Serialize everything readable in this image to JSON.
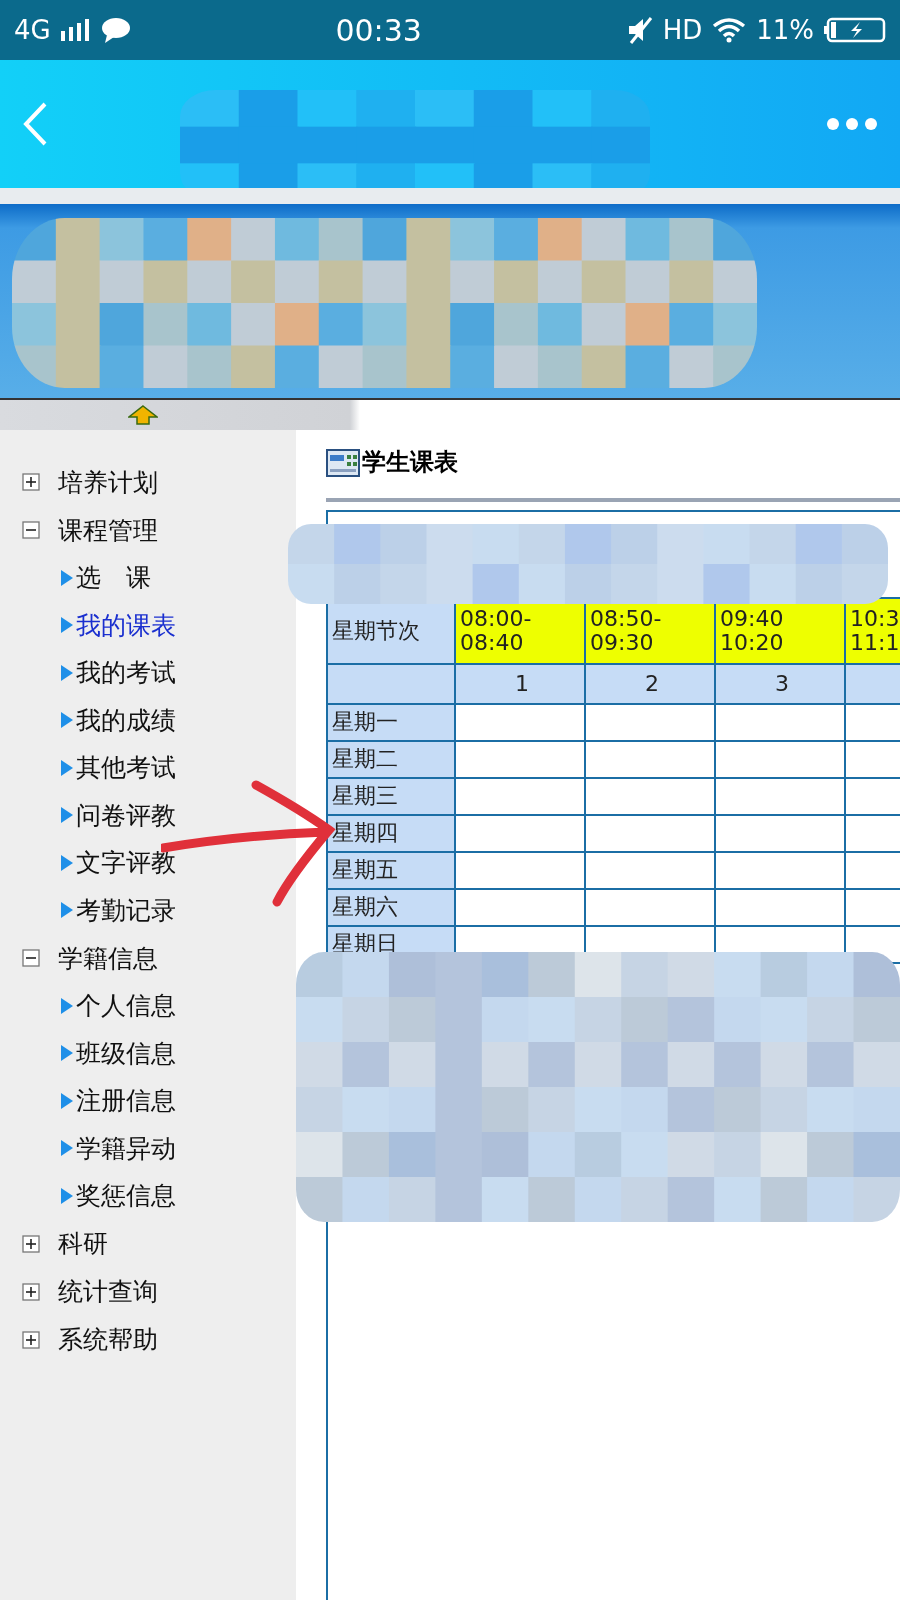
{
  "status_bar": {
    "network": "4G",
    "time": "00:33",
    "hd": "HD",
    "battery": "11%"
  },
  "sidebar": {
    "items": [
      {
        "label": "培养计划",
        "expanded": false
      },
      {
        "label": "课程管理",
        "expanded": true,
        "children": [
          {
            "label": "选　课",
            "selected": false
          },
          {
            "label": "我的课表",
            "selected": true
          },
          {
            "label": "我的考试",
            "selected": false
          },
          {
            "label": "我的成绩",
            "selected": false
          },
          {
            "label": "其他考试",
            "selected": false
          },
          {
            "label": "问卷评教",
            "selected": false
          },
          {
            "label": "文字评教",
            "selected": false
          },
          {
            "label": "考勤记录",
            "selected": false
          }
        ]
      },
      {
        "label": "学籍信息",
        "expanded": true,
        "children": [
          {
            "label": "个人信息",
            "selected": false
          },
          {
            "label": "班级信息",
            "selected": false
          },
          {
            "label": "注册信息",
            "selected": false
          },
          {
            "label": "学籍异动",
            "selected": false
          },
          {
            "label": "奖惩信息",
            "selected": false
          }
        ]
      },
      {
        "label": "科研",
        "expanded": false
      },
      {
        "label": "统计查询",
        "expanded": false
      },
      {
        "label": "系统帮助",
        "expanded": false
      }
    ]
  },
  "content": {
    "title": "学生课表",
    "table": {
      "corner": "星期节次",
      "times": [
        [
          "08:00-",
          "08:40"
        ],
        [
          "08:50-",
          "09:30"
        ],
        [
          "09:40",
          "10:20"
        ],
        [
          "10:3",
          "11:1"
        ]
      ],
      "periods": [
        "1",
        "2",
        "3"
      ],
      "days": [
        "星期一",
        "星期二",
        "星期三",
        "星期四",
        "星期五",
        "星期六",
        "星期日"
      ]
    }
  }
}
